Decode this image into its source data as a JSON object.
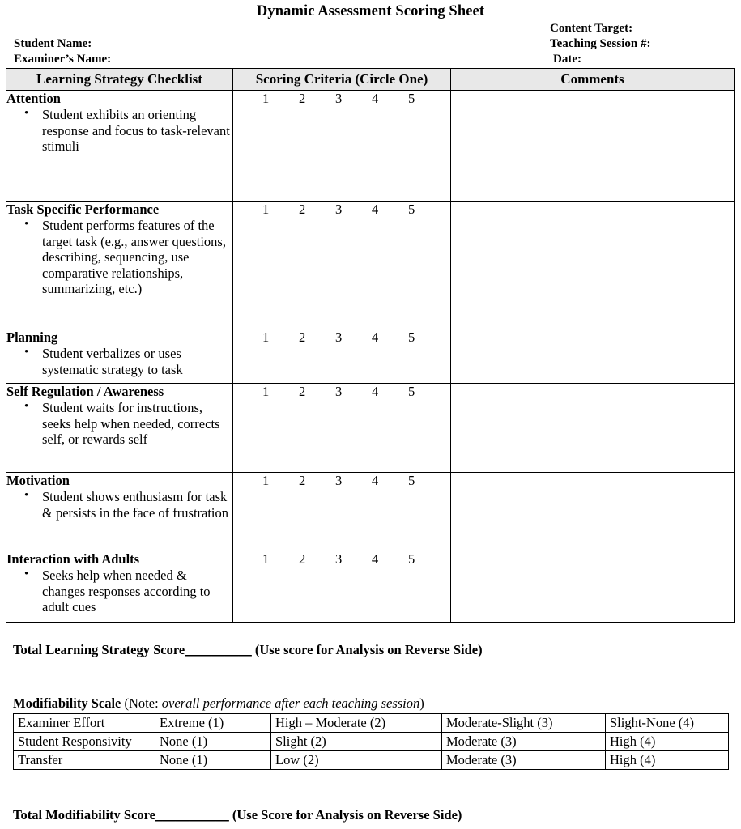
{
  "document": {
    "title": "Dynamic Assessment Scoring Sheet"
  },
  "header": {
    "left_fields": [
      "Student Name:",
      "Examiner’s Name:"
    ],
    "right_fields": [
      "Content Target:",
      "Teaching Session #:",
      "Date:"
    ]
  },
  "checklist_table": {
    "columns": [
      "Learning Strategy Checklist",
      "Scoring Criteria (Circle One)",
      "Comments"
    ],
    "scoring_options": [
      "1",
      "2",
      "3",
      "4",
      "5"
    ],
    "rows": [
      {
        "heading": "Attention",
        "bullets": [
          "Student exhibits an orienting response and focus to task-relevant stimuli"
        ],
        "scores": [
          "1",
          "2",
          "3",
          "4",
          "5"
        ],
        "comment": ""
      },
      {
        "heading": "Task Specific Performance",
        "bullets": [
          "Student performs features of the target task (e.g., answer questions, describing, sequencing, use comparative relationships, summarizing, etc.)"
        ],
        "scores": [
          "1",
          "2",
          "3",
          "4",
          "5"
        ],
        "comment": ""
      },
      {
        "heading": "Planning",
        "bullets": [
          "Student verbalizes or uses systematic strategy to task"
        ],
        "scores": [
          "1",
          "2",
          "3",
          "4",
          "5"
        ],
        "comment": ""
      },
      {
        "heading": "Self Regulation / Awareness",
        "bullets": [
          "Student waits for instructions, seeks help when needed, corrects self, or rewards self"
        ],
        "scores": [
          "1",
          "2",
          "3",
          "4",
          "5"
        ],
        "comment": ""
      },
      {
        "heading": "Motivation",
        "bullets": [
          "Student shows enthusiasm for task & persists in the face of frustration"
        ],
        "scores": [
          "1",
          "2",
          "3",
          "4",
          "5"
        ],
        "comment": ""
      },
      {
        "heading": "Interaction with Adults",
        "bullets": [
          "Seeks help when needed & changes responses according to adult cues"
        ],
        "scores": [
          "1",
          "2",
          "3",
          "4",
          "5"
        ],
        "comment": ""
      }
    ]
  },
  "total_learning_strategy": {
    "label": "Total Learning Strategy Score",
    "blank": "__________",
    "note": " (Use score for Analysis on Reverse Side)"
  },
  "modifiability": {
    "label_bold": "Modifiability Scale",
    "label_note_prefix": " (Note: ",
    "label_note_italic": "overall performance after each teaching session",
    "label_note_suffix": ")",
    "rows": [
      [
        "Examiner Effort",
        "Extreme (1)",
        "High – Moderate (2)",
        "Moderate-Slight (3)",
        "Slight-None (4)"
      ],
      [
        "Student Responsivity",
        "None (1)",
        "Slight (2)",
        "Moderate (3)",
        "High (4)"
      ],
      [
        "Transfer",
        "None (1)",
        "Low (2)",
        "Moderate (3)",
        "High (4)"
      ]
    ]
  },
  "total_modifiability": {
    "label": "Total Modifiability Score",
    "blank": "___________",
    "note": " (Use Score for Analysis on Reverse Side)"
  }
}
